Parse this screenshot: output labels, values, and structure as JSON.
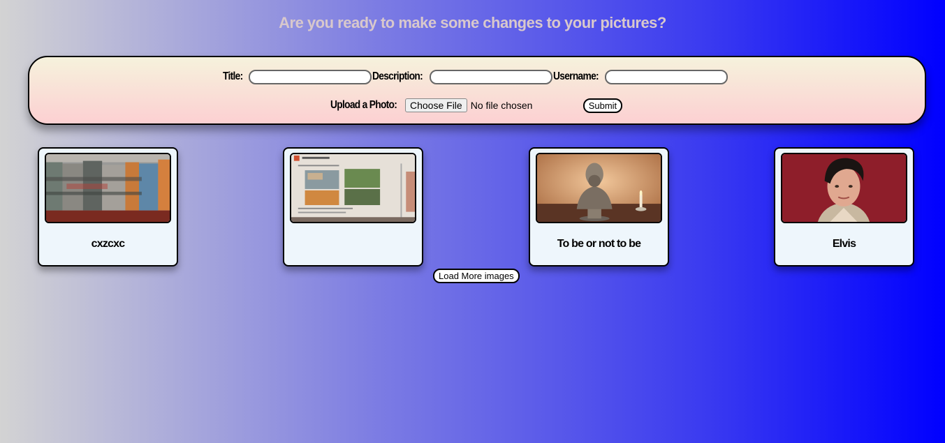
{
  "header": {
    "title": "Are you ready to make some changes to your pictures?"
  },
  "form": {
    "title_label": "Title:",
    "title_value": "",
    "description_label": "Description:",
    "description_value": "",
    "username_label": "Username:",
    "username_value": "",
    "upload_label": "Upload a Photo:",
    "choose_file_label": "Choose File",
    "file_status": "No file chosen",
    "submit_label": "Submit"
  },
  "gallery": {
    "cards": [
      {
        "title": "cxzcxc",
        "image": "blurred-shelf-photo"
      },
      {
        "title": "",
        "image": "textbook-page-photo"
      },
      {
        "title": "To be or not to be",
        "image": "shakespeare-bust-photo"
      },
      {
        "title": "Elvis",
        "image": "elvis-portrait-photo"
      }
    ],
    "load_more_label": "Load More images"
  },
  "colors": {
    "background_start": "#d3d3d3",
    "background_end": "#0000ff",
    "form_top": "#f6f2dc",
    "form_bottom": "#fcd0d2",
    "card_bg": "#eef6fc",
    "heading": "#d8c8cc"
  }
}
